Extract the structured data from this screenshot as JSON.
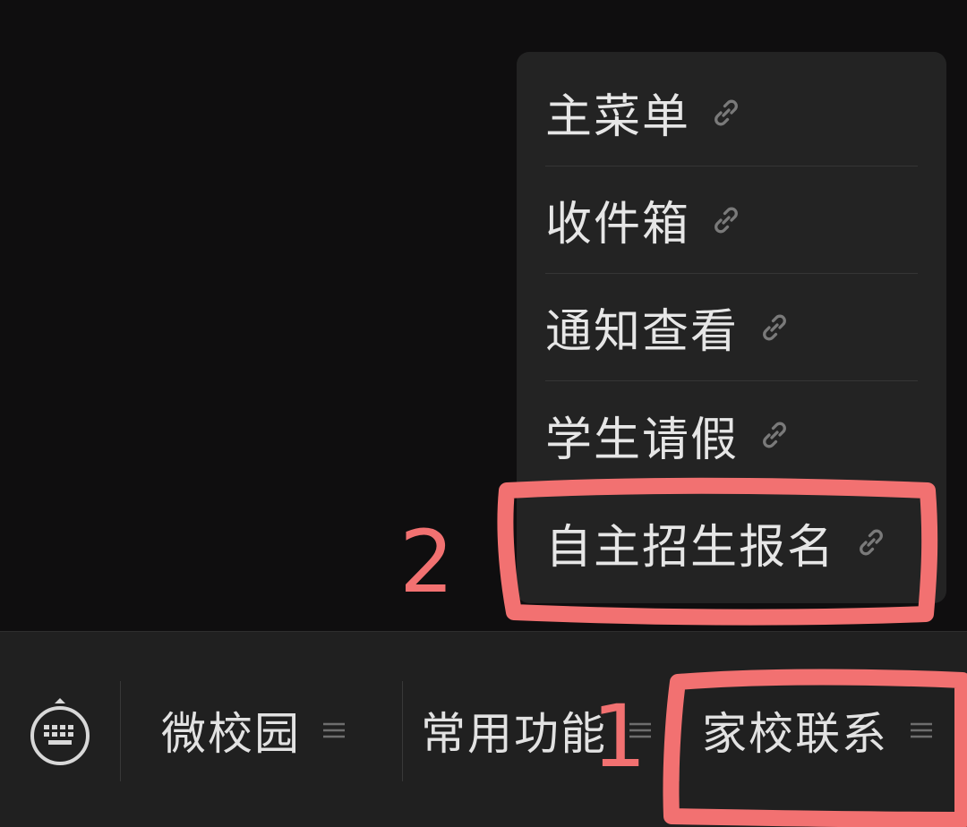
{
  "popup_menu": {
    "items": [
      {
        "label": "主菜单",
        "icon": "link-icon"
      },
      {
        "label": "收件箱",
        "icon": "link-icon"
      },
      {
        "label": "通知查看",
        "icon": "link-icon"
      },
      {
        "label": "学生请假",
        "icon": "link-icon"
      },
      {
        "label": "自主招生报名",
        "icon": "link-icon"
      }
    ]
  },
  "bottom_bar": {
    "keyboard_icon": "keyboard-icon",
    "tabs": [
      {
        "label": "微校园",
        "icon": "menu-lines-icon"
      },
      {
        "label": "常用功能",
        "icon": "menu-lines-icon"
      },
      {
        "label": "家校联系",
        "icon": "menu-lines-icon"
      }
    ]
  },
  "annotations": {
    "step1": "1",
    "step2": "2",
    "color": "#f27171"
  },
  "colors": {
    "background": "#0f0e0f",
    "popup": "#232323",
    "bottom_bar": "#202020",
    "text": "#e6e6e6",
    "highlight": "#f27171"
  }
}
